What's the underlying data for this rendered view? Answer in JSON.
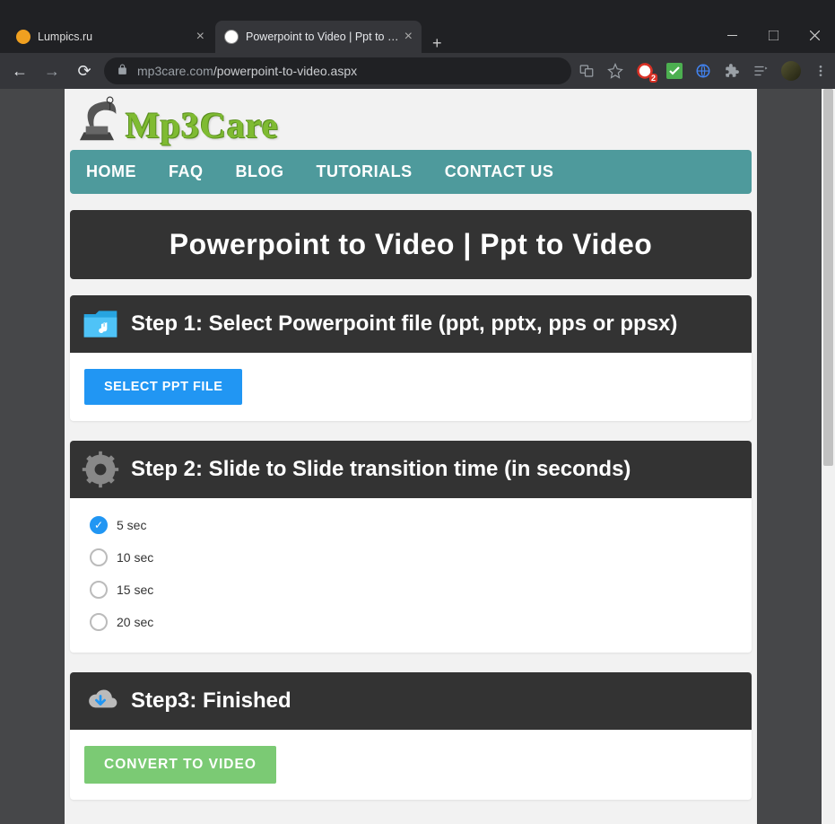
{
  "browser": {
    "tabs": [
      {
        "title": "Lumpics.ru",
        "favicon_color": "#f0a020",
        "active": false
      },
      {
        "title": "Powerpoint to Video | Ppt to Vide",
        "favicon_color": "#ffffff",
        "active": true
      }
    ],
    "url_domain": "mp3care.com",
    "url_path": "/powerpoint-to-video.aspx",
    "extension_badge": "2"
  },
  "logo_text": "Mp3Care",
  "nav": [
    "HOME",
    "FAQ",
    "BLOG",
    "TUTORIALS",
    "CONTACT US"
  ],
  "page_title": "Powerpoint to Video | Ppt to Video",
  "step1": {
    "heading": "Step 1: Select Powerpoint file (ppt, pptx, pps or ppsx)",
    "button": "SELECT PPT FILE"
  },
  "step2": {
    "heading": "Step 2: Slide to Slide transition time (in seconds)",
    "options": [
      "5 sec",
      "10 sec",
      "15 sec",
      "20 sec"
    ],
    "selected": 0
  },
  "step3": {
    "heading": "Step3: Finished",
    "button": "CONVERT TO VIDEO"
  }
}
